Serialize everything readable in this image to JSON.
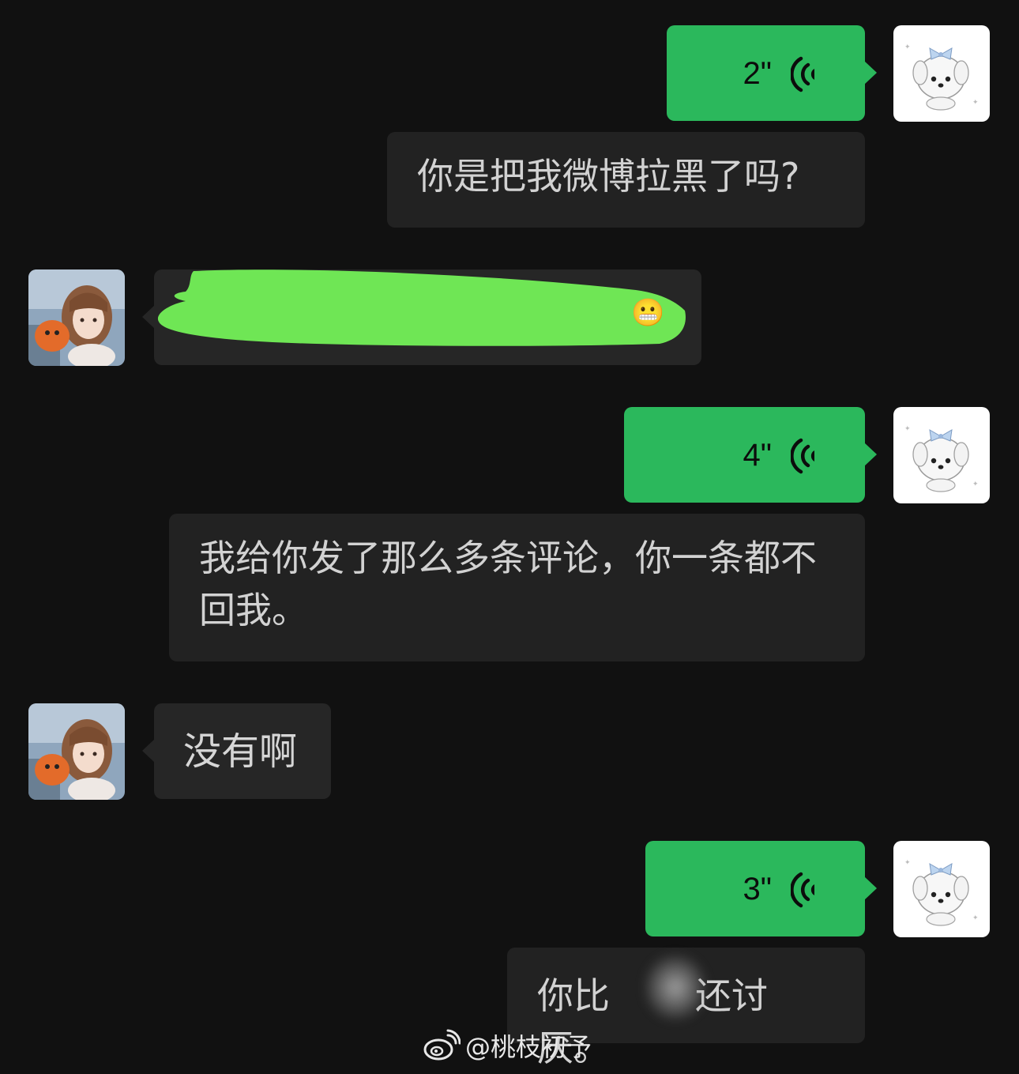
{
  "messages": [
    {
      "side": "right",
      "type": "voice",
      "duration": "2\"",
      "transcript": "你是把我微博拉黑了吗?"
    },
    {
      "side": "left",
      "type": "text",
      "text": "",
      "redacted": true
    },
    {
      "side": "right",
      "type": "voice",
      "duration": "4\"",
      "transcript": "我给你发了那么多条评论，你一条都不回我。"
    },
    {
      "side": "left",
      "type": "text",
      "text": "没有啊"
    },
    {
      "side": "right",
      "type": "voice",
      "duration": "3\"",
      "transcript_part1": "你比",
      "transcript_part2": "还讨厌。",
      "partially_redacted": true
    }
  ],
  "watermark": {
    "icon": "weibo-logo-icon",
    "text": "@桃枝初予"
  },
  "colors": {
    "background": "#111111",
    "voice_bubble": "#2bb85c",
    "incoming_bubble": "#262626",
    "transcript_bubble": "#222222",
    "redaction_highlight": "#6fe655"
  }
}
